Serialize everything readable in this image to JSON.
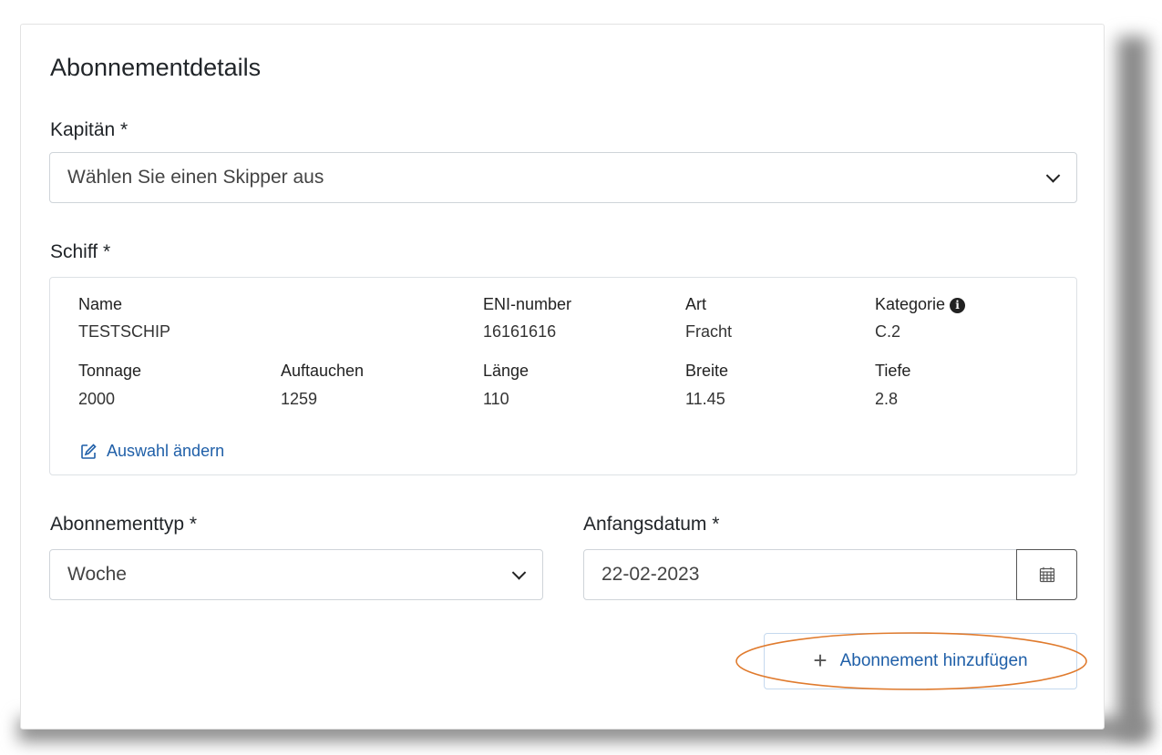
{
  "card": {
    "title": "Abonnementdetails"
  },
  "captain": {
    "label": "Kapitän *",
    "placeholder": "Wählen Sie einen Skipper aus"
  },
  "ship": {
    "label": "Schiff *",
    "fields": {
      "name": {
        "label": "Name",
        "value": "TESTSCHIP"
      },
      "eni": {
        "label": "ENI-number",
        "value": "16161616"
      },
      "art": {
        "label": "Art",
        "value": "Fracht"
      },
      "kategorie": {
        "label": "Kategorie",
        "value": "C.2"
      },
      "tonnage": {
        "label": "Tonnage",
        "value": "2000"
      },
      "auftauchen": {
        "label": "Auftauchen",
        "value": "1259"
      },
      "laenge": {
        "label": "Länge",
        "value": "110"
      },
      "breite": {
        "label": "Breite",
        "value": "11.45"
      },
      "tiefe": {
        "label": "Tiefe",
        "value": "2.8"
      }
    },
    "change_link": "Auswahl ändern"
  },
  "subscription_type": {
    "label": "Abonnementtyp *",
    "value": "Woche"
  },
  "start_date": {
    "label": "Anfangsdatum *",
    "value": "22-02-2023"
  },
  "add_button": {
    "label": "Abonnement hinzufügen"
  },
  "colors": {
    "link": "#1f5fa8",
    "highlight": "#e07b2e",
    "border": "#cfd4d9"
  },
  "icons": {
    "info": "info-icon",
    "edit": "edit-icon",
    "calendar": "calendar-icon",
    "plus": "plus-icon",
    "chevron": "chevron-down-icon"
  }
}
